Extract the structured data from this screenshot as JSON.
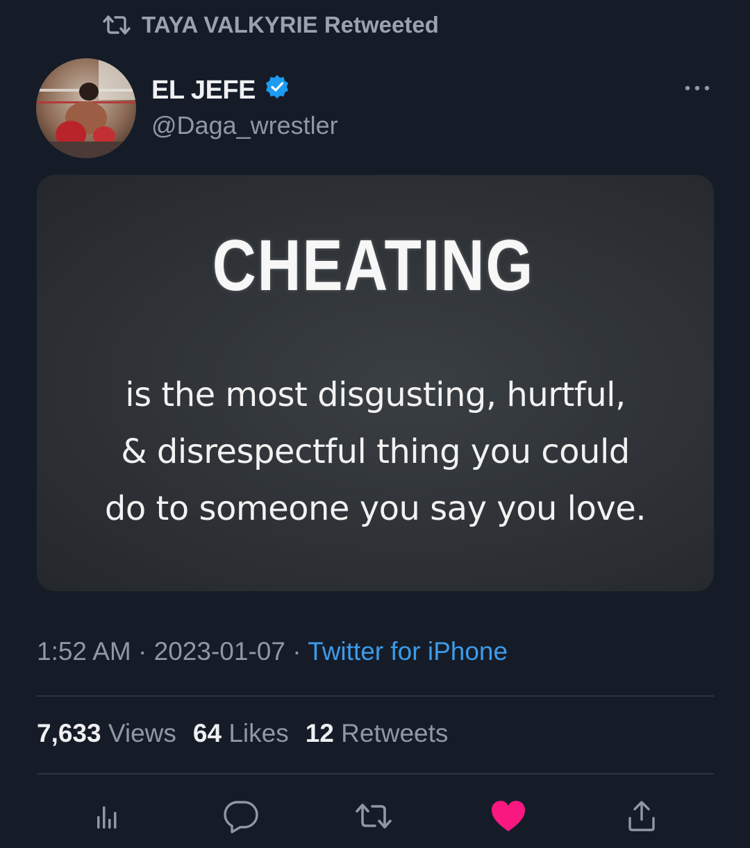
{
  "retweet_header": {
    "label": "TAYA VALKYRIE Retweeted",
    "icon": "retweet-icon"
  },
  "author": {
    "display_name": "EL JEFE",
    "handle": "@Daga_wrestler",
    "verified": true,
    "verified_color": "#1d9bf0"
  },
  "media": {
    "headline": "CHEATING",
    "lines": [
      "is the most disgusting, hurtful,",
      "& disrespectful thing you could",
      "do to someone you say you love."
    ]
  },
  "meta": {
    "time": "1:52 AM",
    "separator": "·",
    "date": "2023-01-07",
    "source": "Twitter for iPhone",
    "source_color": "#3d9be9"
  },
  "stats": {
    "views_count": "7,633",
    "views_label": "Views",
    "likes_count": "64",
    "likes_label": "Likes",
    "retweets_count": "12",
    "retweets_label": "Retweets"
  },
  "actions": {
    "items": [
      "analytics-icon",
      "reply-icon",
      "retweet-icon",
      "like-icon",
      "share-icon"
    ],
    "liked": true,
    "like_color": "#f91880"
  },
  "colors": {
    "background": "#151c28",
    "muted_text": "#8f99a3",
    "primary_text": "#eef0f2"
  }
}
